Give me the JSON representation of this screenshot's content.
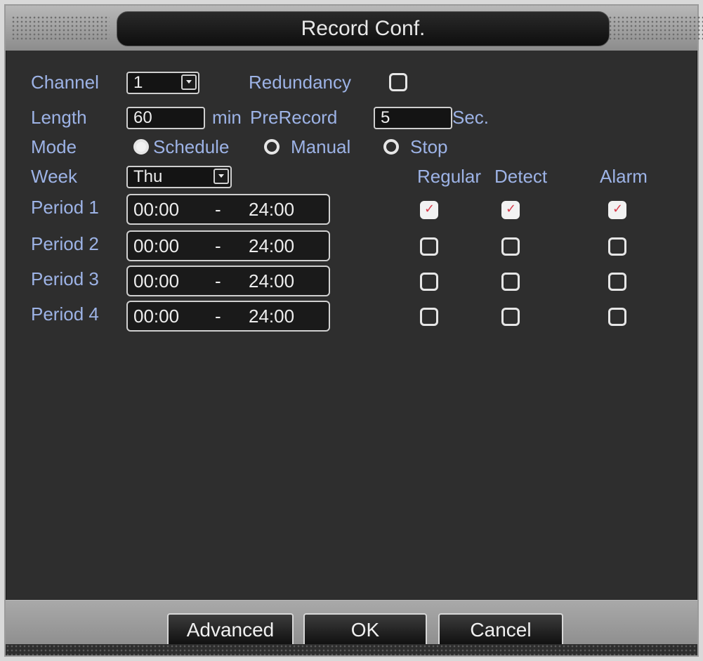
{
  "window": {
    "title": "Record Conf."
  },
  "form": {
    "channel_label": "Channel",
    "channel_value": "1",
    "redundancy_label": "Redundancy",
    "redundancy_checked": false,
    "length_label": "Length",
    "length_value": "60",
    "length_unit": "min",
    "prerecord_label": "PreRecord",
    "prerecord_value": "5",
    "prerecord_unit": "Sec.",
    "mode_label": "Mode",
    "modes": [
      {
        "label": "Schedule",
        "selected": true
      },
      {
        "label": "Manual",
        "selected": false
      },
      {
        "label": "Stop",
        "selected": false
      }
    ],
    "week_label": "Week",
    "week_value": "Thu"
  },
  "columns": {
    "regular": "Regular",
    "detect": "Detect",
    "alarm": "Alarm"
  },
  "periods": [
    {
      "label": "Period 1",
      "start": "00:00",
      "sep": "-",
      "end": "24:00",
      "regular": true,
      "detect": true,
      "alarm": true
    },
    {
      "label": "Period 2",
      "start": "00:00",
      "sep": "-",
      "end": "24:00",
      "regular": false,
      "detect": false,
      "alarm": false
    },
    {
      "label": "Period 3",
      "start": "00:00",
      "sep": "-",
      "end": "24:00",
      "regular": false,
      "detect": false,
      "alarm": false
    },
    {
      "label": "Period 4",
      "start": "00:00",
      "sep": "-",
      "end": "24:00",
      "regular": false,
      "detect": false,
      "alarm": false
    }
  ],
  "buttons": {
    "advanced": "Advanced",
    "ok": "OK",
    "cancel": "Cancel"
  },
  "colors": {
    "label": "#9db3e6",
    "panel": "#2e2e2e",
    "check_mark": "#d63a4a"
  }
}
